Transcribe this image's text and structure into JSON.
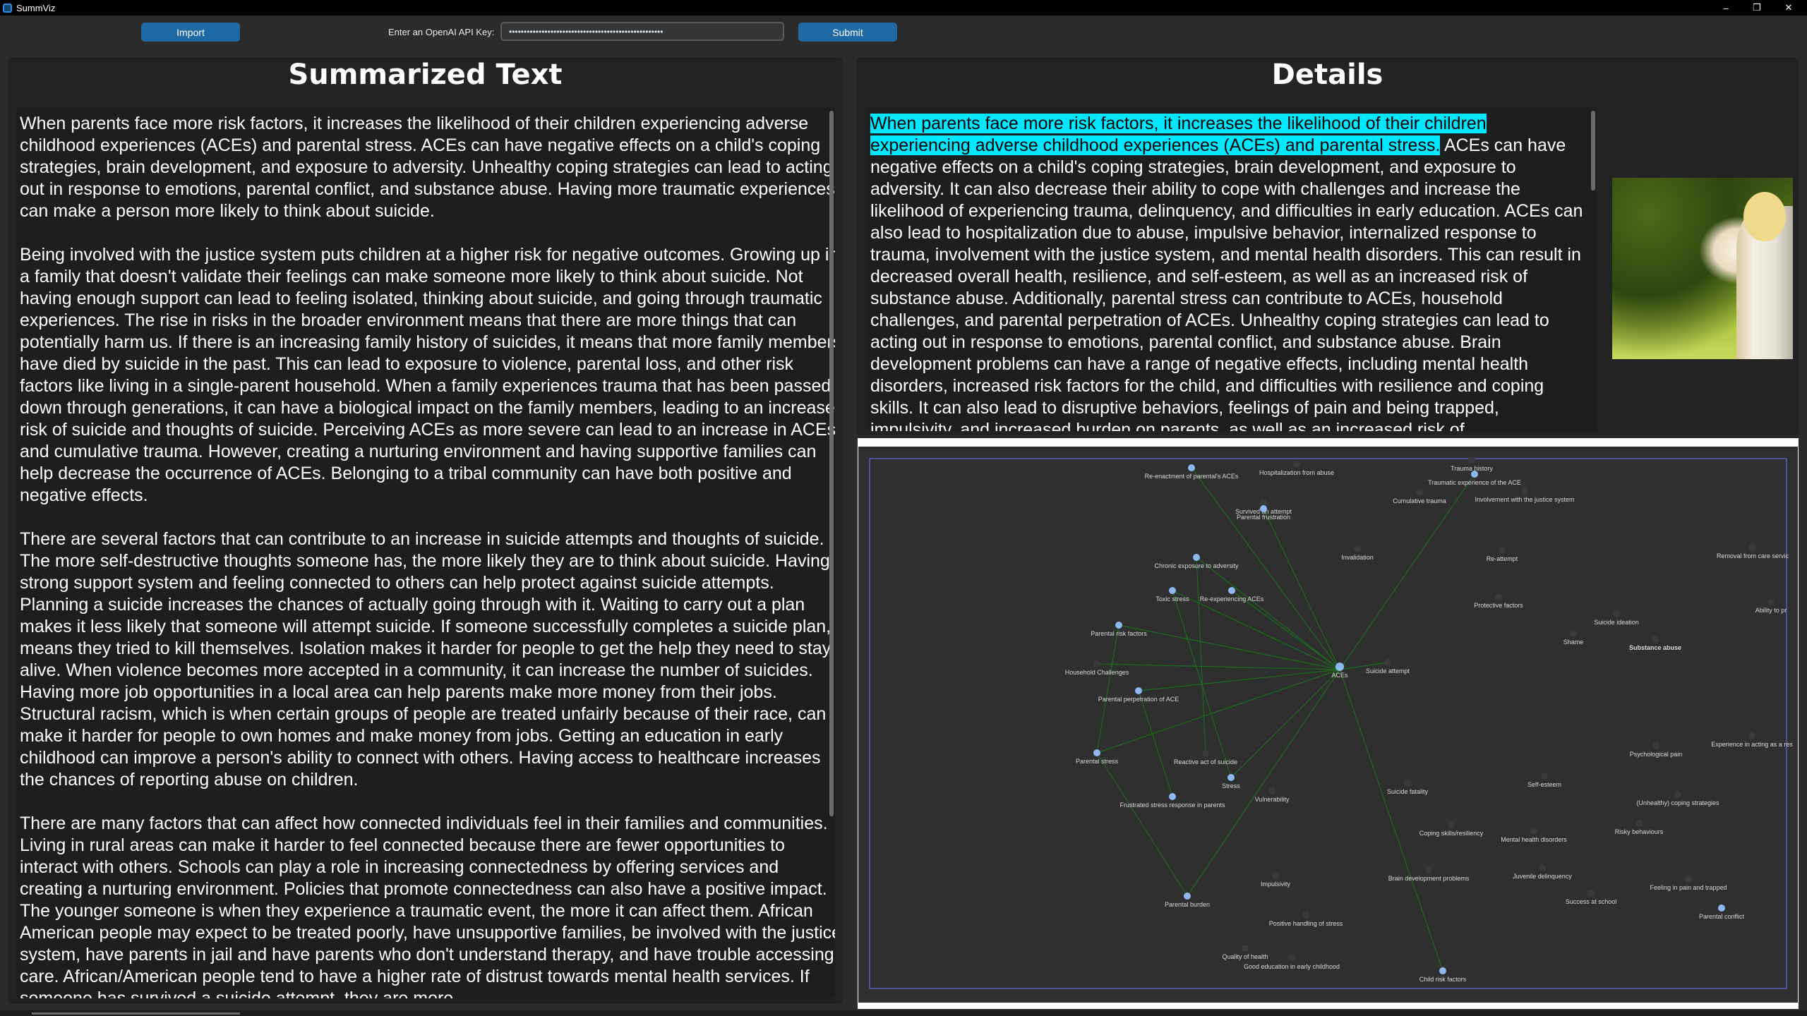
{
  "window": {
    "title": "SummViz",
    "controls": [
      "–",
      "❐",
      "✕"
    ]
  },
  "toolbar": {
    "import_label": "Import",
    "api_label": "Enter an OpenAI API Key:",
    "api_value": "••••••••••••••••••••••••••••••••••••••••••••••••••••",
    "submit_label": "Submit"
  },
  "summary": {
    "title": "Summarized Text",
    "paragraphs": [
      "When parents face more risk factors, it increases the likelihood of their children experiencing adverse childhood experiences (ACEs) and parental stress. ACEs can have negative effects on a child's coping strategies, brain development, and exposure to adversity. Unhealthy coping strategies can lead to acting out in response to emotions, parental conflict, and substance abuse. Having more traumatic experiences can make a person more likely to think about suicide.",
      "Being involved with the justice system puts children at a higher risk for negative outcomes. Growing up in a family that doesn't validate their feelings can make someone more likely to think about suicide. Not having enough support can lead to feeling isolated, thinking about suicide, and going through traumatic experiences. The rise in risks in the broader environment means that there are more things that can potentially harm us. If there is an increasing family history of suicides, it means that more family members have died by suicide in the past. This can lead to exposure to violence, parental loss, and other risk factors like living in a single-parent household. When a family experiences trauma that has been passed down through generations, it can have a biological impact on the family members, leading to an increased risk of suicide and thoughts of suicide. Perceiving ACEs as more severe can lead to an increase in ACEs and cumulative trauma. However, creating a nurturing environment and having supportive families can help decrease the occurrence of ACEs. Belonging to a tribal community can have both positive and negative effects.",
      "There are several factors that can contribute to an increase in suicide attempts and thoughts of suicide. The more self-destructive thoughts someone has, the more likely they are to think about suicide. Having a strong support system and feeling connected to others can help protect against suicide attempts. Planning a suicide increases the chances of actually going through with it. Waiting to carry out a plan makes it less likely that someone will attempt suicide. If someone successfully completes a suicide plan, it means they tried to kill themselves. Isolation makes it harder for people to get the help they need to stay alive. When violence becomes more accepted in a community, it can increase the number of suicides. Having more job opportunities in a local area can help parents make more money from their jobs. Structural racism, which is when certain groups of people are treated unfairly because of their race, can make it harder for people to own homes and make money from jobs. Getting an education in early childhood can improve a person's ability to connect with others. Having access to healthcare increases the chances of reporting abuse on children.",
      "There are many factors that can affect how connected individuals feel in their families and communities. Living in rural areas can make it harder to feel connected because there are fewer opportunities to interact with others. Schools can play a role in increasing connectedness by offering services and creating a nurturing environment. Policies that promote connectedness can also have a positive impact. The younger someone is when they experience a traumatic event, the more it can affect them. African American people may expect to be treated poorly, have unsupportive families, be involved with the justice system, have parents in jail and have parents who don't understand therapy, and have trouble accessing care. African/American people tend to have a higher rate of distrust towards mental health services. If someone has survived a suicide attempt, they are more"
    ]
  },
  "details": {
    "title": "Details",
    "highlighted": "When parents face more risk factors, it increases the likelihood of their children experiencing adverse childhood experiences (ACEs) and parental stress.",
    "body": " ACEs can have negative effects on a child's coping strategies, brain development, and exposure to adversity. It can also decrease their ability to cope with challenges and increase the likelihood of experiencing trauma, delinquency, and difficulties in early education. ACEs can also lead to hospitalization due to abuse, impulsive behavior, internalized response to trauma, involvement with the justice system, and mental health disorders. This can result in decreased overall health, resilience, and self-esteem, as well as an increased risk of substance abuse. Additionally, parental stress can contribute to ACEs, household challenges, and parental perpetration of ACEs. Unhealthy coping strategies can lead to acting out in response to emotions, parental conflict, and substance abuse. Brain development problems can have a range of negative effects, including mental health disorders, increased risk factors for the child, and difficulties with resilience and coping skills. It can also lead to disruptive behaviors, feelings of pain and being trapped, impulsivity, and increased burden on parents, as well as an increased risk of",
    "image": "child-in-grass-photo"
  },
  "graph": {
    "center": "ACEs",
    "nodes": [
      {
        "label": "Hospitalization from abuse",
        "highlight": false
      },
      {
        "label": "Trauma history",
        "highlight": false
      },
      {
        "label": "Re-enactment of parental's ACEs",
        "highlight": true
      },
      {
        "label": "Traumatic experience of the ACE",
        "highlight": true
      },
      {
        "label": "Cumulative trauma",
        "highlight": false
      },
      {
        "label": "Involvement with the justice system",
        "highlight": false
      },
      {
        "label": "Survived an attempt",
        "highlight": false
      },
      {
        "label": "Parental frustration",
        "highlight": true
      },
      {
        "label": "Invalidation",
        "highlight": false
      },
      {
        "label": "Re-attempt",
        "highlight": false
      },
      {
        "label": "Removal from care servic",
        "highlight": false
      },
      {
        "label": "Chronic exposure to adversity",
        "highlight": true
      },
      {
        "label": "Toxic stress",
        "highlight": true
      },
      {
        "label": "Re-experiencing ACEs",
        "highlight": true
      },
      {
        "label": "Protective factors",
        "highlight": false
      },
      {
        "label": "Ability to pr",
        "highlight": false
      },
      {
        "label": "Suicide ideation",
        "highlight": false
      },
      {
        "label": "Parental risk factors",
        "highlight": true
      },
      {
        "label": "Shame",
        "highlight": false
      },
      {
        "label": "Substance abuse",
        "highlight": false,
        "bold": true
      },
      {
        "label": "Household Challenges",
        "highlight": false
      },
      {
        "label": "Suicide attempt",
        "highlight": false
      },
      {
        "label": "ACEs",
        "highlight": true
      },
      {
        "label": "Parental perpetration of ACE",
        "highlight": true
      },
      {
        "label": "Experience in acting as a res",
        "highlight": false
      },
      {
        "label": "Psychological pain",
        "highlight": false
      },
      {
        "label": "Reactive act of suicide",
        "highlight": false
      },
      {
        "label": "Parental stress",
        "highlight": true
      },
      {
        "label": "Stress",
        "highlight": true
      },
      {
        "label": "Self-esteem",
        "highlight": false
      },
      {
        "label": "Vulnerability",
        "highlight": false
      },
      {
        "label": "Suicide fatality",
        "highlight": false
      },
      {
        "label": "(Unhealthy) coping strategies",
        "highlight": false
      },
      {
        "label": "Frustrated stress response in parents",
        "highlight": true
      },
      {
        "label": "Risky behaviours",
        "highlight": false
      },
      {
        "label": "Coping skills/resiliency",
        "highlight": false
      },
      {
        "label": "Mental health disorders",
        "highlight": false
      },
      {
        "label": "Impulsivity",
        "highlight": false
      },
      {
        "label": "Brain development problems",
        "highlight": false
      },
      {
        "label": "Juvenile delinquency",
        "highlight": false
      },
      {
        "label": "Feeling in pain and trapped",
        "highlight": false
      },
      {
        "label": "Success at school",
        "highlight": false
      },
      {
        "label": "Parental burden",
        "highlight": true
      },
      {
        "label": "Positive handling of stress",
        "highlight": false
      },
      {
        "label": "Parental conflict",
        "highlight": true
      },
      {
        "label": "Quality of health",
        "highlight": false
      },
      {
        "label": "Good education in early childhood",
        "highlight": false
      },
      {
        "label": "Child risk factors",
        "highlight": true
      }
    ]
  },
  "colors": {
    "accent": "#1f6aa5",
    "highlight": "#00e8ff",
    "node_highlight": "#8fb8f0",
    "node_dim": "#3a3a3a",
    "edge": "#1d6b1d"
  }
}
